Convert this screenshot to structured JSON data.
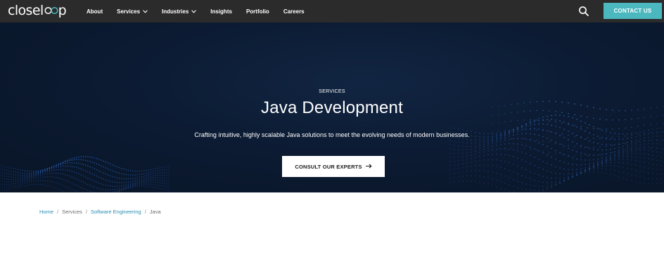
{
  "header": {
    "logo": {
      "text_before": "closel",
      "text_after": "p"
    },
    "nav": [
      {
        "label": "About",
        "has_dropdown": false
      },
      {
        "label": "Services",
        "has_dropdown": true
      },
      {
        "label": "Industries",
        "has_dropdown": true
      },
      {
        "label": "Insights",
        "has_dropdown": false
      },
      {
        "label": "Portfolio",
        "has_dropdown": false
      },
      {
        "label": "Careers",
        "has_dropdown": false
      }
    ],
    "search_icon": "search-icon",
    "contact_label": "CONTACT US"
  },
  "hero": {
    "eyebrow": "SERVICES",
    "title": "Java Development",
    "subtitle": "Crafting intuitive, highly scalable Java solutions to meet the evolving needs of modern businesses.",
    "cta_label": "CONSULT OUR EXPERTS",
    "cta_icon": "arrow-right-icon"
  },
  "breadcrumb": {
    "items": [
      {
        "label": "Home",
        "link": true
      },
      {
        "label": "Services",
        "link": false
      },
      {
        "label": "Software Engineering",
        "link": true
      },
      {
        "label": "Java",
        "link": false
      }
    ],
    "separator": "/"
  },
  "colors": {
    "navbar": "#2b2b2b",
    "accent": "#4bb8bf",
    "hero_bg": "#0c1b33",
    "link": "#2a8fb3"
  }
}
